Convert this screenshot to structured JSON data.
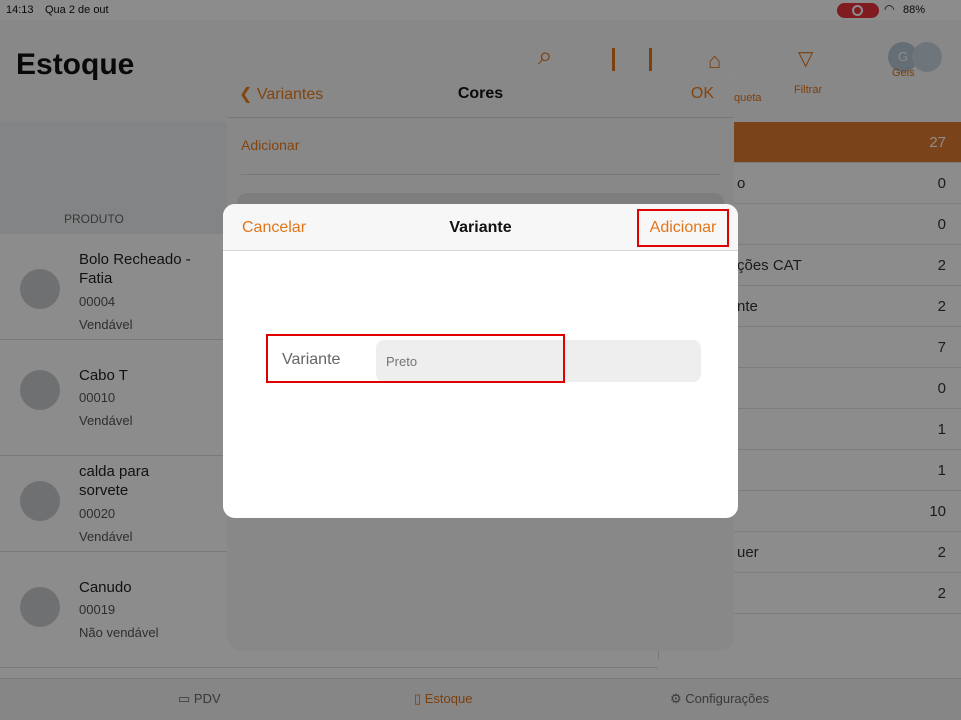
{
  "status_bar": {
    "time": "14:13",
    "date": "Qua 2 de out",
    "battery": "88%"
  },
  "app": {
    "title": "Estoque",
    "header_labels": {
      "tag": "queta",
      "filter": "Filtrar",
      "user": "Geis",
      "avatar_initial": "G"
    },
    "column_header": "PRODUTO",
    "products": [
      {
        "name": "Bolo Recheado - Fatia",
        "code": "00004",
        "status": "Vendável"
      },
      {
        "name": "Cabo T",
        "code": "00010",
        "status": "Vendável"
      },
      {
        "name": "calda para sorvete",
        "code": "00020",
        "status": "Vendável"
      },
      {
        "name": "Canudo",
        "code": "00019",
        "status": "Não vendável"
      }
    ],
    "categories": [
      {
        "label": "",
        "count": "27"
      },
      {
        "label": "o",
        "count": "0"
      },
      {
        "label": "",
        "count": "0"
      },
      {
        "label": "ções CAT",
        "count": "2"
      },
      {
        "label": "nte",
        "count": "2"
      },
      {
        "label": "",
        "count": "7"
      },
      {
        "label": "",
        "count": "0"
      },
      {
        "label": "",
        "count": "1"
      },
      {
        "label": "",
        "count": "1"
      },
      {
        "label": "",
        "count": "10"
      },
      {
        "label": "uer",
        "count": "2"
      },
      {
        "label": "",
        "count": "2"
      }
    ],
    "tabs": [
      {
        "label": "PDV"
      },
      {
        "label": "Estoque"
      },
      {
        "label": "Configurações"
      }
    ]
  },
  "cores_sheet": {
    "back_label": "Variantes",
    "title": "Cores",
    "ok_label": "OK",
    "add_label": "Adicionar"
  },
  "variante_dialog": {
    "cancel_label": "Cancelar",
    "title": "Variante",
    "add_label": "Adicionar",
    "field_label": "Variante",
    "field_placeholder": "Preto"
  },
  "colors": {
    "accent": "#e2761b",
    "highlight_box": "#e00000",
    "active_row": "#e07a2e"
  }
}
